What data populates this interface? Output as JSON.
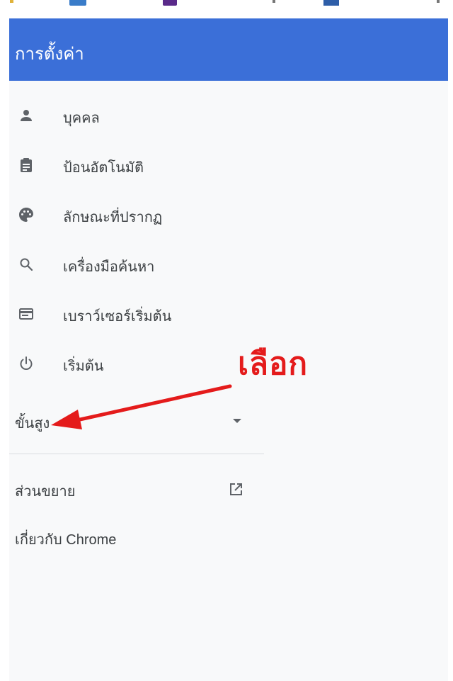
{
  "header": {
    "title": "การตั้งค่า"
  },
  "menu": {
    "items": [
      {
        "label": "บุคคล",
        "icon": "person-icon"
      },
      {
        "label": "ป้อนอัตโนมัติ",
        "icon": "clipboard-icon"
      },
      {
        "label": "ลักษณะที่ปรากฏ",
        "icon": "palette-icon"
      },
      {
        "label": "เครื่องมือค้นหา",
        "icon": "search-icon"
      },
      {
        "label": "เบราว์เซอร์เริ่มต้น",
        "icon": "browser-window-icon"
      },
      {
        "label": "เริ่มต้น",
        "icon": "power-icon"
      }
    ]
  },
  "advanced": {
    "label": "ขั้นสูง",
    "icon": "caret-down-icon"
  },
  "links": {
    "extensions": {
      "label": "ส่วนขยาย",
      "icon": "open-in-new-icon"
    },
    "about": {
      "label": "เกี่ยวกับ Chrome"
    }
  },
  "annotation": {
    "text": "เลือก",
    "color": "#e41b1b"
  },
  "colors": {
    "header_bg": "#3b6fd8",
    "panel_bg": "#f8f9fa",
    "icon": "#5f6368"
  }
}
